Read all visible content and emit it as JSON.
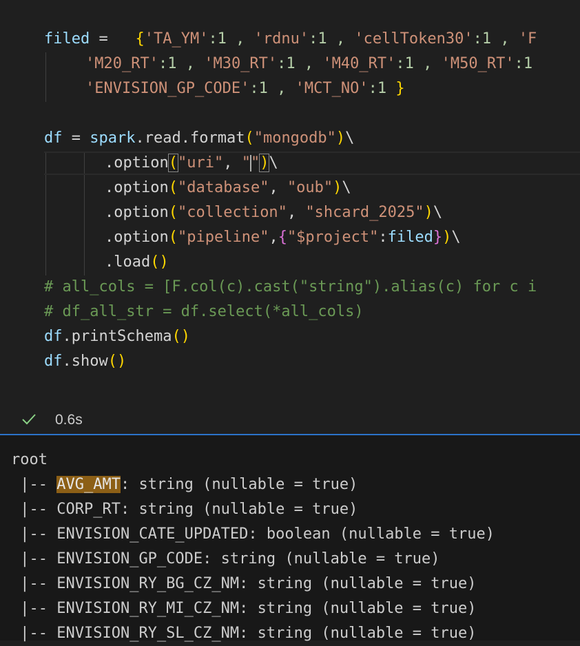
{
  "code": {
    "line1": {
      "lhs": "filed",
      "eq": " =   ",
      "open": "{",
      "s1": "'TA_YM'",
      "n1": ":1 , ",
      "s2": "'rdnu'",
      "n2": ":1 , ",
      "s3": "'cellToken30'",
      "n3": ":1 , ",
      "s4": "'F"
    },
    "line2": {
      "s1": "'M20_RT'",
      "n1": ":1 , ",
      "s2": "'M30_RT'",
      "n2": ":1 , ",
      "s3": "'M40_RT'",
      "n3": ":1 , ",
      "s4": "'M50_RT'",
      "n4": ":1"
    },
    "line3": {
      "s1": "'ENVISION_GP_CODE'",
      "n1": ":1 , ",
      "s2": "'MCT_NO'",
      "n2": ":1 ",
      "close": "}"
    },
    "line4": {
      "lhs": "df",
      "eq": " = ",
      "obj": "spark",
      "dot1": ".",
      "attr": "read",
      "dot2": ".",
      "fn": "format",
      "op": "(",
      "arg": "\"mongodb\"",
      "cl": ")",
      "bs": "\\"
    },
    "line5": {
      "dot": ".",
      "fn": "option",
      "op": "(",
      "a1": "\"uri\"",
      "comma": ", ",
      "q1": "\"",
      "q2": "\"",
      "cl": ")",
      "bs": "\\"
    },
    "line6": {
      "dot": ".",
      "fn": "option",
      "op": "(",
      "a1": "\"database\"",
      "comma": ", ",
      "a2": "\"oub\"",
      "cl": ")",
      "bs": "\\"
    },
    "line7": {
      "dot": ".",
      "fn": "option",
      "op": "(",
      "a1": "\"collection\"",
      "comma": ", ",
      "a2": "\"shcard_2025\"",
      "cl": ")",
      "bs": "\\"
    },
    "line8": {
      "dot": ".",
      "fn": "option",
      "op": "(",
      "a1": "\"pipeline\"",
      "comma": ",",
      "ob": "{",
      "key": "\"$project\"",
      "colon": ":",
      "var": "filed",
      "cb": "}",
      "cl": ")",
      "bs": "\\"
    },
    "line9": {
      "dot": ".",
      "fn": "load",
      "paren": "()"
    },
    "line10": "# all_cols = [F.col(c).cast(\"string\").alias(c) for c i",
    "line11": "# df_all_str = df.select(*all_cols)",
    "line12": {
      "obj": "df",
      "dot": ".",
      "fn": "printSchema",
      "paren": "()"
    },
    "line13": {
      "obj": "df",
      "dot": ".",
      "fn": "show",
      "paren": "()"
    }
  },
  "status": {
    "check_icon": "check-icon",
    "time": "0.6s",
    "check_color": "#89d185"
  },
  "output": {
    "root": "root",
    "rows": [
      {
        "prefix": " |-- ",
        "name": "AVG_AMT",
        "rest": ": string (nullable = true)"
      },
      {
        "prefix": " |-- ",
        "name": "CORP_RT",
        "rest": ": string (nullable = true)"
      },
      {
        "prefix": " |-- ",
        "name": "ENVISION_CATE_UPDATED",
        "rest": ": boolean (nullable = true)"
      },
      {
        "prefix": " |-- ",
        "name": "ENVISION_GP_CODE",
        "rest": ": string (nullable = true)"
      },
      {
        "prefix": " |-- ",
        "name": "ENVISION_RY_BG_CZ_NM",
        "rest": ": string (nullable = true)"
      },
      {
        "prefix": " |-- ",
        "name": "ENVISION_RY_MI_CZ_NM",
        "rest": ": string (nullable = true)"
      },
      {
        "prefix": " |-- ",
        "name": "ENVISION_RY_SL_CZ_NM",
        "rest": ": string (nullable = true)"
      }
    ]
  },
  "colors": {
    "accent": "#2b73c9",
    "highlight": "#8c5f16",
    "string": "#ce9178",
    "variable": "#9cdcfe",
    "function": "#dcdcaa",
    "comment": "#6a9955"
  }
}
